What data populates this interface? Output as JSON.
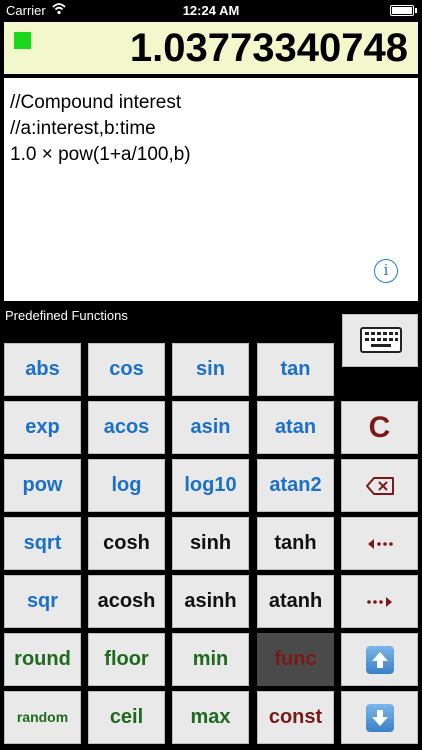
{
  "status_bar": {
    "carrier": "Carrier",
    "time": "12:24 AM"
  },
  "display": {
    "result": "1.03773340748"
  },
  "editor": {
    "lines": [
      "//Compound interest",
      "//a:interest,b:time",
      "1.0 × pow(1+a/100,b)"
    ],
    "info_label": "i"
  },
  "section_label": "Predefined Functions",
  "keys": {
    "abs": "abs",
    "cos": "cos",
    "sin": "sin",
    "tan": "tan",
    "exp": "exp",
    "acos": "acos",
    "asin": "asin",
    "atan": "atan",
    "pow": "pow",
    "log": "log",
    "log10": "log10",
    "atan2": "atan2",
    "sqrt": "sqrt",
    "cosh": "cosh",
    "sinh": "sinh",
    "tanh": "tanh",
    "sqr": "sqr",
    "acosh": "acosh",
    "asinh": "asinh",
    "atanh": "atanh",
    "round": "round",
    "floor": "floor",
    "min": "min",
    "func": "func",
    "random": "random",
    "ceil": "ceil",
    "max": "max",
    "const": "const",
    "clear": "C"
  },
  "icons": {
    "keyboard": "keyboard-icon",
    "backspace": "backspace-icon",
    "cursor_left": "cursor-left-icon",
    "cursor_right": "cursor-right-icon",
    "up": "arrow-up-icon",
    "down": "arrow-down-icon"
  },
  "colors": {
    "display_bg": "#f2f8cc",
    "indicator": "#1ad81a",
    "key_bg": "#e9e9e9",
    "blue": "#1b70c9",
    "green": "#1f6a1f",
    "maroon": "#7b1818"
  }
}
